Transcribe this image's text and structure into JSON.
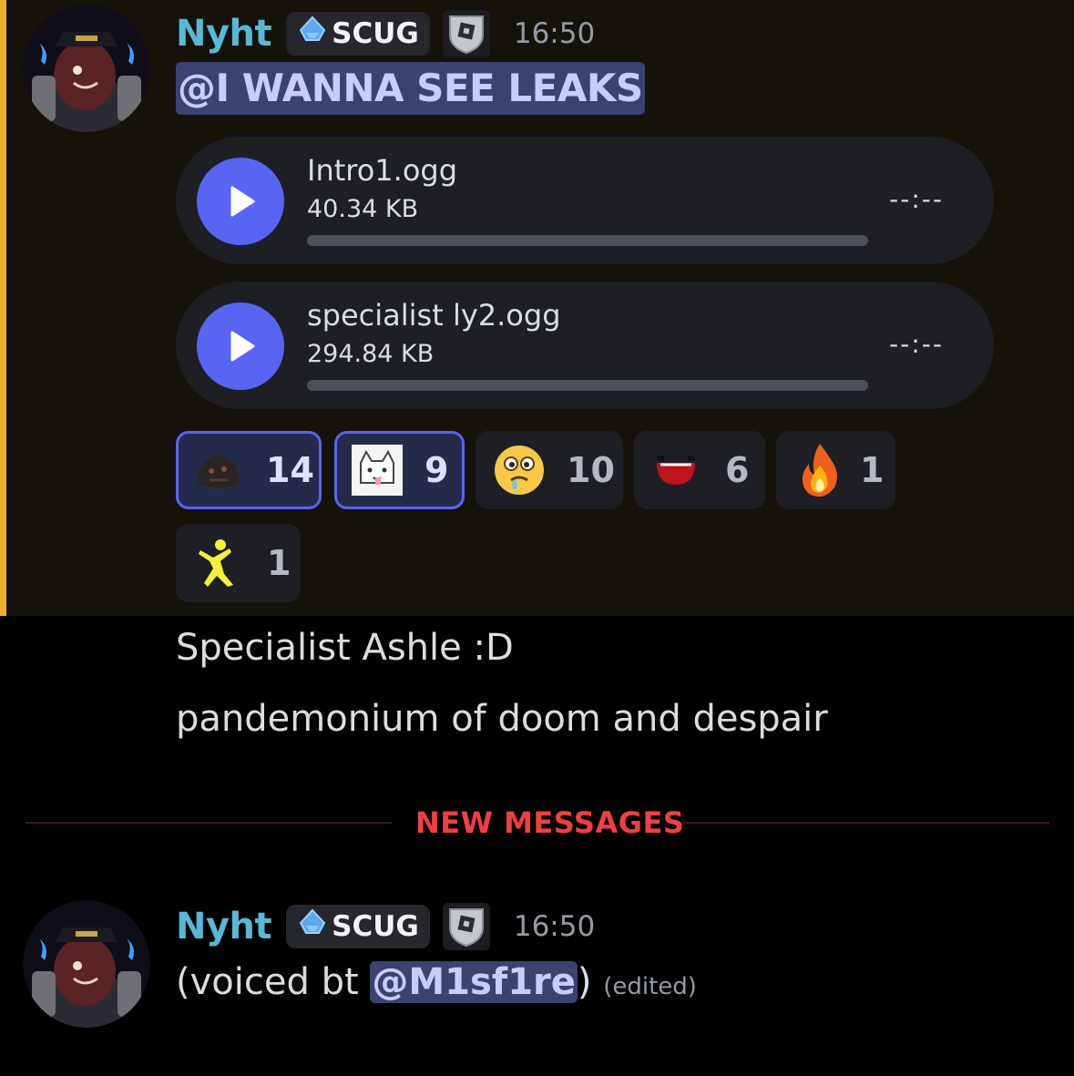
{
  "colors": {
    "username": "#58b9d6",
    "mention_bg": "#3c4270",
    "highlight_bar": "#f0b132",
    "new_messages": "#f23f42",
    "play_button": "#5865f2"
  },
  "message1": {
    "username": "Nyht",
    "tag": "SCUG",
    "tag_icon": "diamond-icon",
    "badge_icon": "shield-badge-icon",
    "timestamp": "16:50",
    "mention": "@I WANNA SEE LEAKS",
    "attachments": [
      {
        "filename": "Intro1.ogg",
        "size": "40.34 KB",
        "time": "--:--"
      },
      {
        "filename": "specialist ly2.ogg",
        "size": "294.84 KB",
        "time": "--:--"
      }
    ],
    "reactions": [
      {
        "emoji": "dark-creature-emoji",
        "count": "14",
        "me": true
      },
      {
        "emoji": "white-cat-emoji",
        "count": "9",
        "me": true
      },
      {
        "emoji": "drooling-face-emoji",
        "count": "10",
        "me": false
      },
      {
        "emoji": "red-grin-emoji",
        "count": "6",
        "me": false
      },
      {
        "emoji": "fire-emoji",
        "count": "1",
        "me": false
      },
      {
        "emoji": "yellow-dancer-emoji",
        "count": "1",
        "me": false
      }
    ]
  },
  "followups": [
    "Specialist Ashle :D",
    "pandemonium of doom and despair"
  ],
  "divider": {
    "label": "NEW MESSAGES"
  },
  "message2": {
    "username": "Nyht",
    "tag": "SCUG",
    "timestamp": "16:50",
    "text_before": "(voiced bt ",
    "mention": "@M1sf1re",
    "text_after": ")",
    "edited": "(edited)"
  }
}
